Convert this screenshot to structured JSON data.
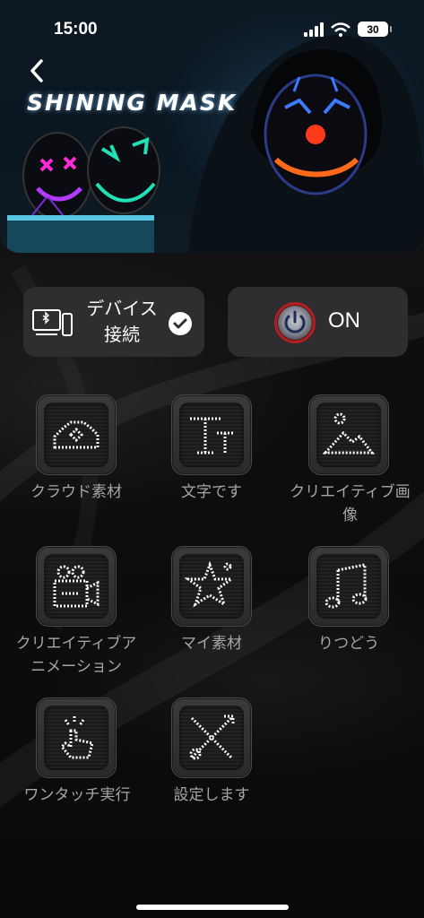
{
  "status_bar": {
    "time": "15:00",
    "battery": "30"
  },
  "header": {
    "brand": "SHINING MASK"
  },
  "controls": {
    "device_connect_label": "デバイス\n接続",
    "power_label": "ON"
  },
  "menu": [
    {
      "label": "クラウド素材",
      "icon": "cloud-icon"
    },
    {
      "label": "文字です",
      "icon": "text-icon"
    },
    {
      "label": "クリエイティブ画像",
      "icon": "mountain-image-icon"
    },
    {
      "label": "クリエイティブアニメーション",
      "icon": "video-camera-icon"
    },
    {
      "label": "マイ素材",
      "icon": "star-icon"
    },
    {
      "label": "りつどう",
      "icon": "music-note-icon"
    },
    {
      "label": "ワンタッチ実行",
      "icon": "tap-hand-icon"
    },
    {
      "label": "設定します",
      "icon": "tools-icon"
    }
  ],
  "colors": {
    "accent_red": "#b01f1f",
    "tile_label": "#a6a6a8",
    "card_bg": "#2e2e31"
  }
}
